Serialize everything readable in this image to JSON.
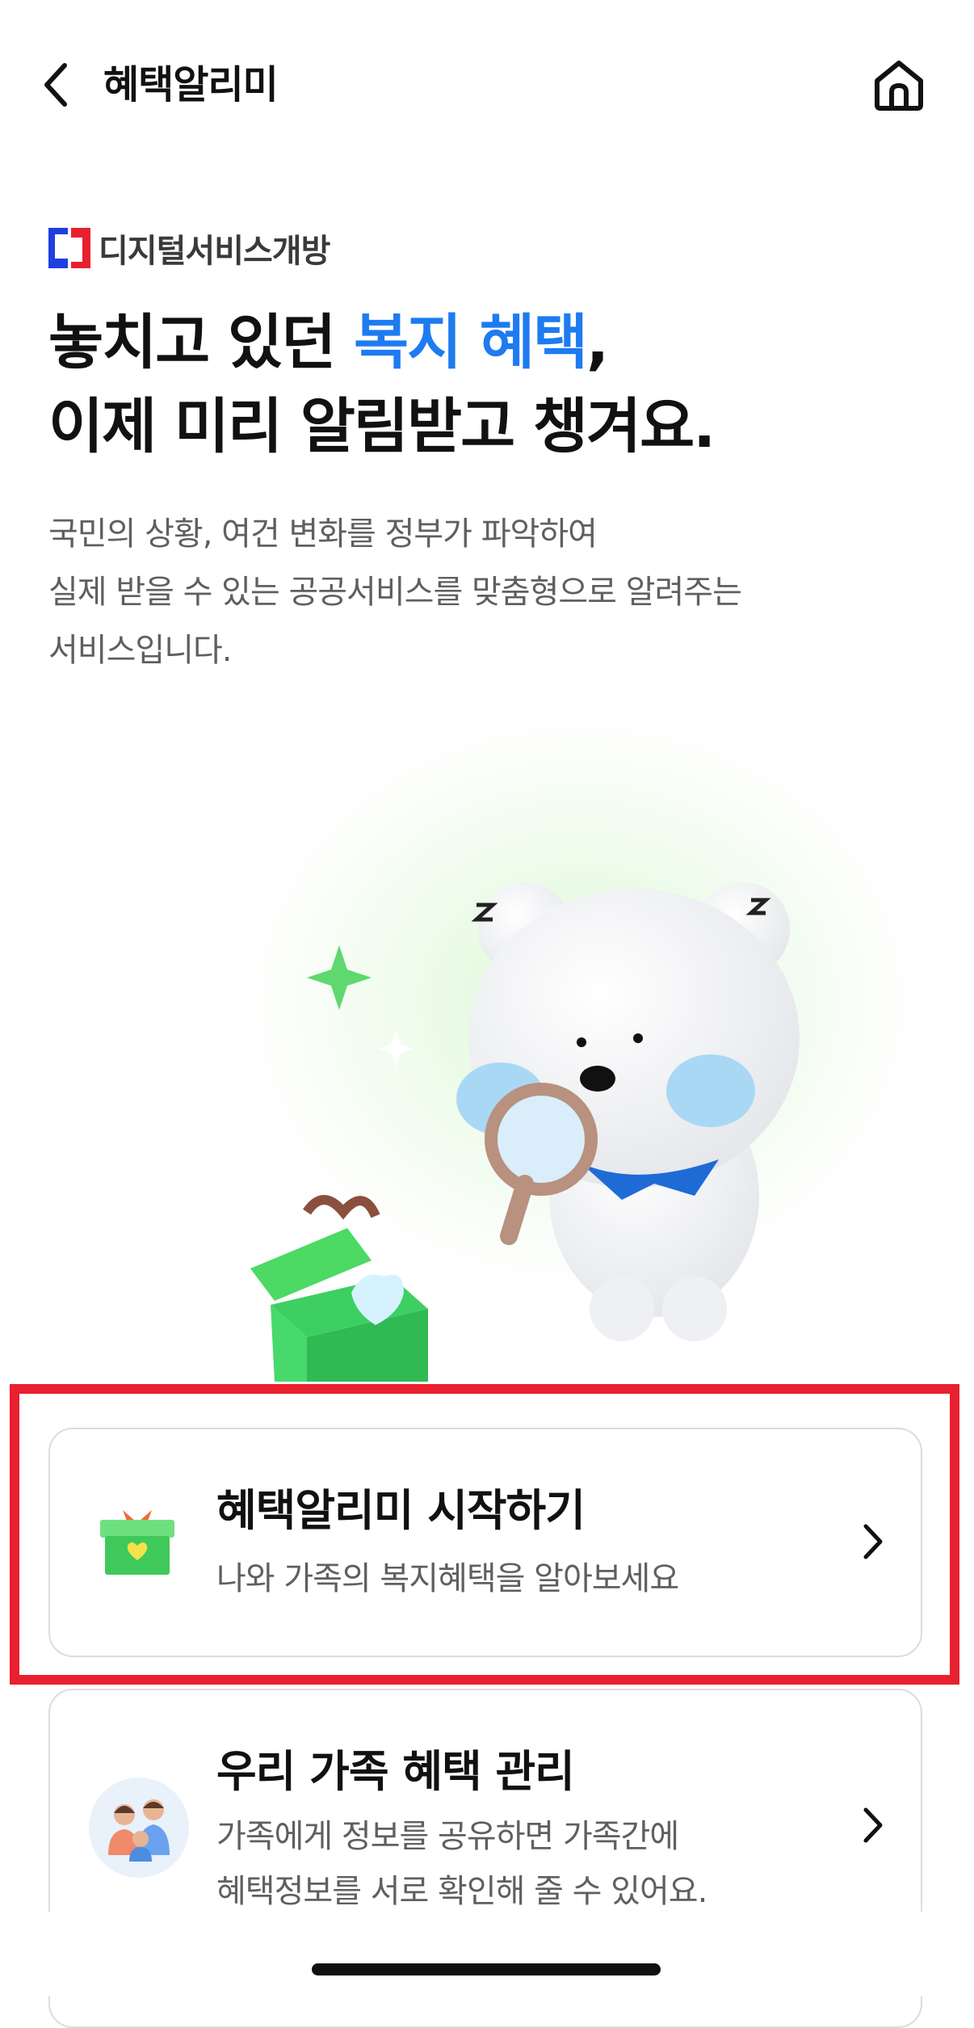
{
  "header": {
    "title": "혜택알리미",
    "back_icon": "chevron-left-icon",
    "home_icon": "home-icon"
  },
  "brand": {
    "text": "디지털서비스개방",
    "colors": {
      "blue": "#1f3fe0",
      "red": "#e8202f"
    }
  },
  "headline": {
    "line1_prefix": "놓치고 있던 ",
    "line1_accent": "복지 혜택",
    "line1_suffix": ",",
    "line2": "이제 미리 알림받고 챙겨요."
  },
  "description": {
    "line1": "국민의 상황, 여건 변화를 정부가 파악하여",
    "line2": "실제 받을 수 있는 공공서비스를 맞춤형으로 알려주는",
    "line3": "서비스입니다."
  },
  "cards": [
    {
      "title": "혜택알리미 시작하기",
      "subtitle": "나와 가족의 복지혜택을 알아보세요",
      "icon": "gift-box-icon"
    },
    {
      "title": "우리 가족 혜택 관리",
      "subtitle_line1": "가족에게 정보를 공유하면 가족간에",
      "subtitle_line2": "혜택정보를 서로 확인해 줄 수 있어요.",
      "icon": "family-icon"
    }
  ],
  "colors": {
    "accent": "#1e7bf0",
    "highlight": "#e8202f",
    "gift_green": "#4cd964"
  }
}
